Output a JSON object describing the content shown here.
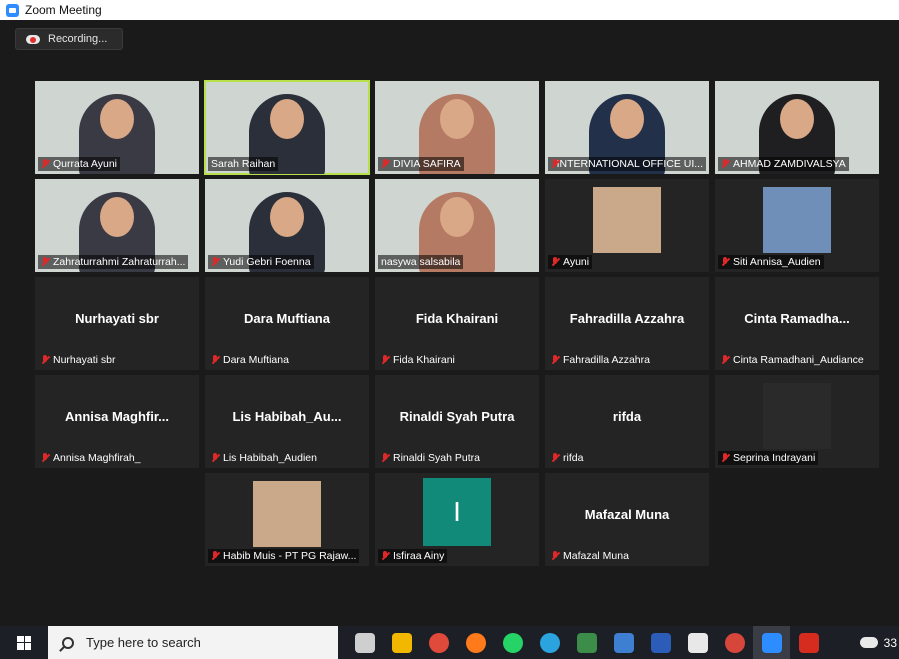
{
  "window": {
    "title": "Zoom Meeting"
  },
  "recording": {
    "label": "Recording..."
  },
  "colors": {
    "accent_active": "#b8e04a",
    "muted_mic": "#e02828",
    "avatar_initial_bg": "#128a7a"
  },
  "participants": [
    {
      "name": "Qurrata  Ayuni",
      "type": "video",
      "bg": "bg-white"
    },
    {
      "name": "Sarah Raihan",
      "type": "video",
      "bg": "bg-green",
      "active": true
    },
    {
      "name": "DIVIA SAFIRA",
      "type": "video",
      "bg": "bg-green"
    },
    {
      "name": "INTERNATIONAL OFFICE UI...",
      "type": "video",
      "bg": "bg-wall"
    },
    {
      "name": "AHMAD ZAMDIVALSYA",
      "type": "video",
      "bg": "bg-green"
    },
    {
      "name": "Zahraturrahmi Zahraturrah...",
      "type": "video",
      "bg": "bg-white"
    },
    {
      "name": "Yudi Gebri Foenna",
      "type": "video",
      "bg": "bg-wall"
    },
    {
      "name": "nasywa salsabila",
      "type": "video",
      "bg": "bg-green"
    },
    {
      "name": "Ayuni",
      "type": "photo"
    },
    {
      "name": "Siti Annisa_Audien",
      "type": "photo"
    },
    {
      "name": "Nurhayati sbr",
      "display": "Nurhayati sbr",
      "type": "audio"
    },
    {
      "name": "Dara Muftiana",
      "display": "Dara Muftiana",
      "type": "audio"
    },
    {
      "name": "Fida Khairani",
      "display": "Fida Khairani",
      "type": "audio"
    },
    {
      "name": "Fahradilla Azzahra",
      "display": "Fahradilla Azzahra",
      "type": "audio"
    },
    {
      "name": "Cinta Ramadhani_Audiance",
      "display": "Cinta  Ramadha...",
      "type": "audio"
    },
    {
      "name": "Annisa Maghfirah_",
      "display": "Annisa  Maghfir...",
      "type": "audio"
    },
    {
      "name": "Lis Habibah_Audien",
      "display": "Lis  Habibah_Au...",
      "type": "audio"
    },
    {
      "name": "Rinaldi Syah Putra",
      "display": "Rinaldi Syah Putra",
      "type": "audio"
    },
    {
      "name": "rifda",
      "display": "rifda",
      "type": "audio"
    },
    {
      "name": "Seprina Indrayani",
      "type": "photo"
    },
    {
      "name": "Habib Muis - PT PG Rajaw...",
      "type": "photo"
    },
    {
      "name": "Isfiraa Ainy",
      "type": "initial",
      "initial": "I"
    },
    {
      "name": "Mafazal Muna",
      "display": "Mafazal Muna",
      "type": "audio"
    }
  ],
  "taskbar": {
    "search_placeholder": "Type here to search",
    "apps": [
      "task-view",
      "file-explorer",
      "chrome",
      "firefox",
      "whatsapp",
      "telegram",
      "calculator",
      "notes",
      "word",
      "app-diamond",
      "chrome-profile",
      "zoom",
      "acrobat"
    ],
    "weather_temp": "33"
  }
}
